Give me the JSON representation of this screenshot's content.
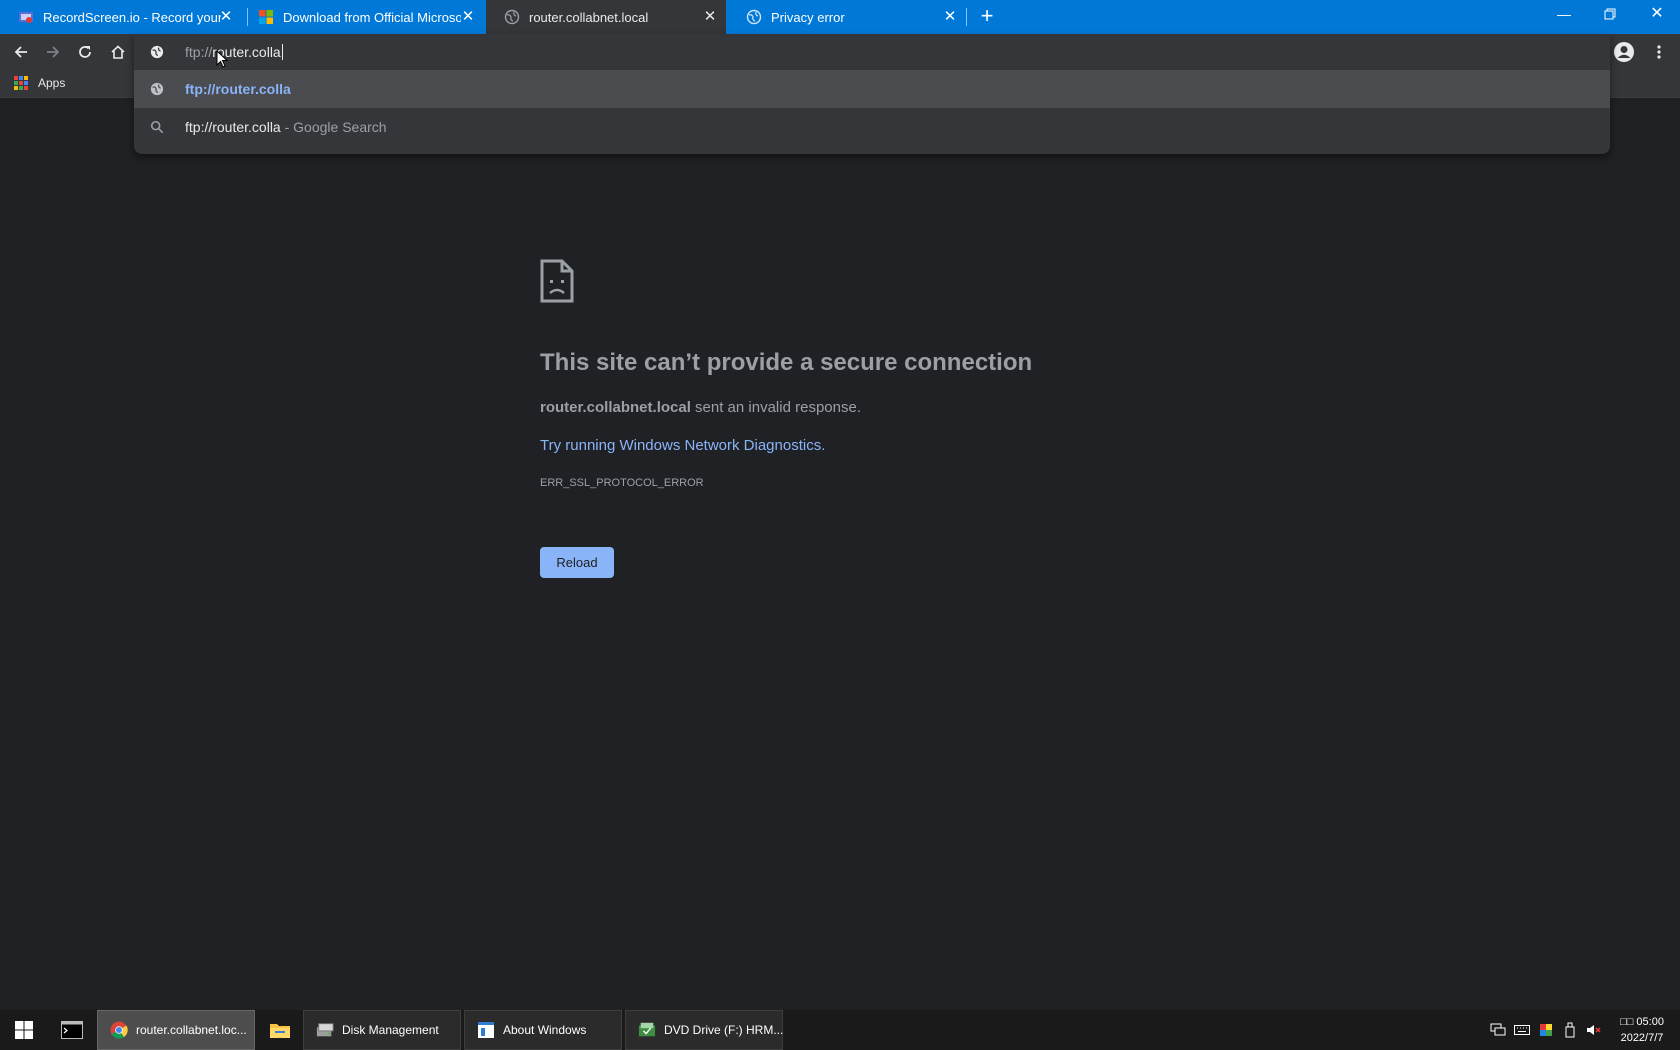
{
  "tabs": [
    {
      "title": "RecordScreen.io - Record your sc",
      "favicon": "recordscreen-icon",
      "active": false
    },
    {
      "title": "Download from Official Microsof",
      "favicon": "microsoft-icon",
      "active": false
    },
    {
      "title": "router.collabnet.local",
      "favicon": "globe-icon",
      "active": true
    },
    {
      "title": "Privacy error",
      "favicon": "globe-icon",
      "active": false
    }
  ],
  "omnibox": {
    "input_prefix": "ftp://",
    "input_rest": "router.colla",
    "suggestions": [
      {
        "text": "ftp://router.colla",
        "suffix": "",
        "icon": "globe-icon",
        "selected": true
      },
      {
        "text": "ftp://router.colla",
        "suffix": " - Google Search",
        "icon": "search-icon",
        "selected": false
      }
    ]
  },
  "bookmarks": {
    "apps_label": "Apps"
  },
  "error": {
    "title": "This site can’t provide a secure connection",
    "host": "router.collabnet.local",
    "message": " sent an invalid response.",
    "link": "Try running Windows Network Diagnostics.",
    "code": "ERR_SSL_PROTOCOL_ERROR",
    "reload_label": "Reload"
  },
  "taskbar": {
    "items": [
      {
        "label": "router.collabnet.loc...",
        "icon": "chrome-icon"
      },
      {
        "label": "",
        "icon": "file-explorer-icon"
      },
      {
        "label": "Disk Management",
        "icon": "disk-management-icon"
      },
      {
        "label": "About Windows",
        "icon": "about-windows-icon"
      },
      {
        "label": "DVD Drive (F:) HRM...",
        "icon": "dvd-drive-icon"
      }
    ],
    "clock_time": "□□ 05:00",
    "clock_date": "2022/7/7"
  },
  "colors": {
    "tabstrip": "#0078d7",
    "toolbar": "#35363a",
    "page_bg": "#202124",
    "link": "#8ab4f8",
    "taskbar": "#1a1a1a"
  }
}
